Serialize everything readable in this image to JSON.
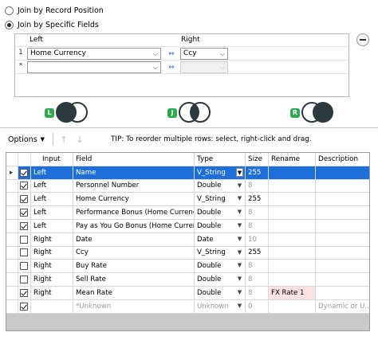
{
  "join_options": {
    "by_position_label": "Join by Record Position",
    "by_fields_label": "Join by Specific Fields",
    "selected": "fields"
  },
  "mapping": {
    "left_header": "Left",
    "right_header": "Right",
    "rows": [
      {
        "num": "1",
        "left": "Home Currency",
        "right": "Ccy"
      },
      {
        "num": "*",
        "left": "",
        "right": ""
      }
    ]
  },
  "join_outputs": [
    {
      "badge": "L",
      "kind": "left"
    },
    {
      "badge": "J",
      "kind": "join"
    },
    {
      "badge": "R",
      "kind": "right"
    }
  ],
  "toolbar": {
    "options_label": "Options",
    "tip": "TIP: To reorder multiple rows: select, right-click and drag."
  },
  "table": {
    "headers": {
      "input": "Input",
      "field": "Field",
      "type": "Type",
      "size": "Size",
      "rename": "Rename",
      "description": "Description"
    },
    "rows": [
      {
        "checked": true,
        "input": "Left",
        "field": "Name",
        "type": "V_String",
        "size": "255",
        "rename": "",
        "description": "",
        "selected": true,
        "muted": false
      },
      {
        "checked": true,
        "input": "Left",
        "field": "Personnel Number",
        "type": "Double",
        "size": "8",
        "rename": "",
        "description": "",
        "selected": false,
        "muted": false
      },
      {
        "checked": true,
        "input": "Left",
        "field": "Home Currency",
        "type": "V_String",
        "size": "255",
        "rename": "",
        "description": "",
        "selected": false,
        "muted": false
      },
      {
        "checked": true,
        "input": "Left",
        "field": "Performance Bonus (Home Currency)",
        "type": "Double",
        "size": "8",
        "rename": "",
        "description": "",
        "selected": false,
        "muted": false
      },
      {
        "checked": true,
        "input": "Left",
        "field": "Pay as You Go Bonus (Home Currency)",
        "type": "Double",
        "size": "8",
        "rename": "",
        "description": "",
        "selected": false,
        "muted": false
      },
      {
        "checked": false,
        "input": "Right",
        "field": "Date",
        "type": "Date",
        "size": "10",
        "rename": "",
        "description": "",
        "selected": false,
        "muted": false
      },
      {
        "checked": false,
        "input": "Right",
        "field": "Ccy",
        "type": "V_String",
        "size": "255",
        "rename": "",
        "description": "",
        "selected": false,
        "muted": false
      },
      {
        "checked": false,
        "input": "Right",
        "field": "Buy Rate",
        "type": "Double",
        "size": "8",
        "rename": "",
        "description": "",
        "selected": false,
        "muted": false
      },
      {
        "checked": false,
        "input": "Right",
        "field": "Sell Rate",
        "type": "Double",
        "size": "8",
        "rename": "",
        "description": "",
        "selected": false,
        "muted": false
      },
      {
        "checked": true,
        "input": "Right",
        "field": "Mean Rate",
        "type": "Double",
        "size": "8",
        "rename": "FX Rate 1",
        "description": "",
        "selected": false,
        "muted": false
      },
      {
        "checked": true,
        "input": "",
        "field": "*Unknown",
        "type": "Unknown",
        "size": "0",
        "rename": "",
        "description": "Dynamic or U...",
        "selected": false,
        "muted": true
      }
    ]
  },
  "colors": {
    "selection": "#1e6fd9",
    "link_arrow": "#1f6fc4",
    "join_green": "#2fa84f",
    "rename_highlight": "#fbe1e1"
  }
}
